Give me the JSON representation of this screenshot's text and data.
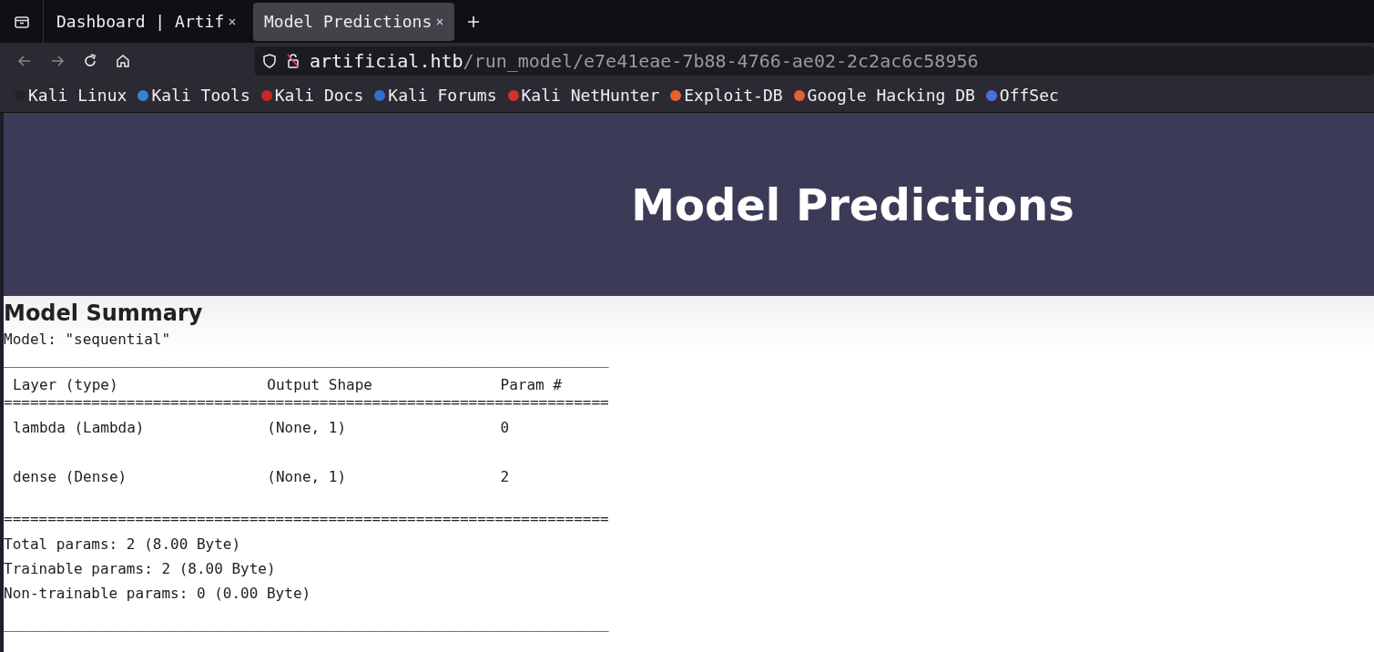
{
  "tabs": [
    {
      "label": "Dashboard | Artif",
      "selected": false
    },
    {
      "label": "Model Predictions",
      "selected": true
    }
  ],
  "address": {
    "host": "artificial.htb",
    "path": "/run_model/e7e41eae-7b88-4766-ae02-2c2ac6c58956"
  },
  "bookmarks": [
    {
      "label": "Kali Linux",
      "color": "#222222"
    },
    {
      "label": "Kali Tools",
      "color": "#3b82d6"
    },
    {
      "label": "Kali Docs",
      "color": "#c62828"
    },
    {
      "label": "Kali Forums",
      "color": "#2f6fd0"
    },
    {
      "label": "Kali NetHunter",
      "color": "#d32f2f"
    },
    {
      "label": "Exploit-DB",
      "color": "#e8602c"
    },
    {
      "label": "Google Hacking DB",
      "color": "#e8602c"
    },
    {
      "label": "OffSec",
      "color": "#4a6ee0"
    }
  ],
  "page": {
    "title": "Model Predictions",
    "section": "Model Summary",
    "model_line": "Model: \"sequential\"",
    "rule_top": "_____________________________________________________________________",
    "columns": [
      "Layer (type)",
      "Output Shape",
      "Param #"
    ],
    "rule_double": "=====================================================================",
    "rows": [
      [
        "lambda (Lambda)",
        "(None, 1)",
        "0"
      ],
      [
        "dense (Dense)",
        "(None, 1)",
        "2"
      ]
    ],
    "rule_double_2": "=====================================================================",
    "totals": [
      "Total params: 2 (8.00 Byte)",
      "Trainable params: 2 (8.00 Byte)",
      "Non-trainable params: 0 (0.00 Byte)"
    ],
    "rule_bottom": "_____________________________________________________________________"
  }
}
